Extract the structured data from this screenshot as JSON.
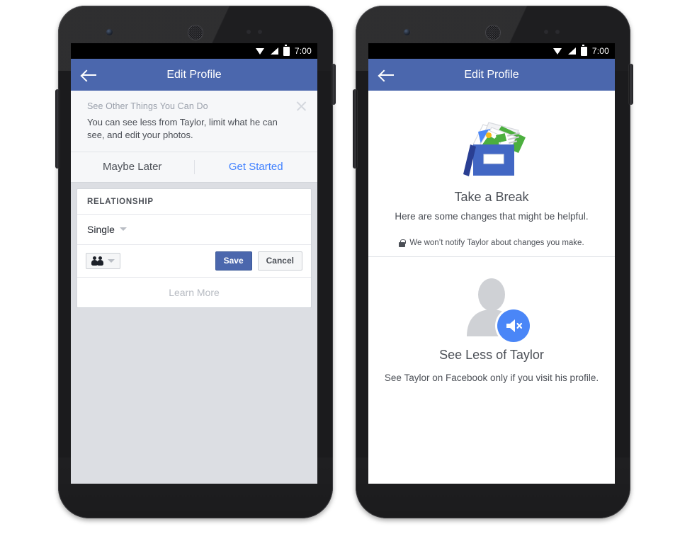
{
  "statusbar": {
    "time": "7:00",
    "icons": [
      "wifi-icon",
      "signal-icon",
      "battery-icon"
    ]
  },
  "appbar": {
    "title": "Edit Profile",
    "back_icon": "back-arrow-icon"
  },
  "navbar": {
    "back": "nav-back-icon",
    "home": "nav-home-icon",
    "recents": "nav-recents-icon"
  },
  "phone_left": {
    "nux": {
      "heading": "See Other Things You Can Do",
      "body": "You can see less from Taylor, limit what he can see, and edit your photos.",
      "close_icon": "close-icon",
      "secondary_label": "Maybe Later",
      "primary_label": "Get Started"
    },
    "card": {
      "section_header": "RELATIONSHIP",
      "value": "Single",
      "value_caret_icon": "chevron-down-icon",
      "audience_icon": "friends-icon",
      "audience_caret_icon": "chevron-down-icon",
      "save_label": "Save",
      "cancel_label": "Cancel",
      "learn_more_label": "Learn More"
    }
  },
  "phone_right": {
    "hero": {
      "illustration": "archive-box-icon",
      "title": "Take a Break",
      "subtitle": "Here are some changes that might be helpful."
    },
    "notify": {
      "lock_icon": "lock-icon",
      "text": "We won’t notify Taylor about changes you make."
    },
    "section": {
      "avatar_icon": "person-silhouette-icon",
      "badge_icon": "mute-speaker-icon",
      "title": "See Less of Taylor",
      "subtitle": "See Taylor on Facebook only if you visit his profile."
    }
  },
  "colors": {
    "facebook_blue": "#4b67ad",
    "link_blue": "#4080ff",
    "badge_blue": "#4a86f7",
    "screen_bg": "#dcdee3",
    "text_primary": "#1d2129",
    "text_secondary": "#4b4f56",
    "text_muted": "#9aa0ab"
  }
}
